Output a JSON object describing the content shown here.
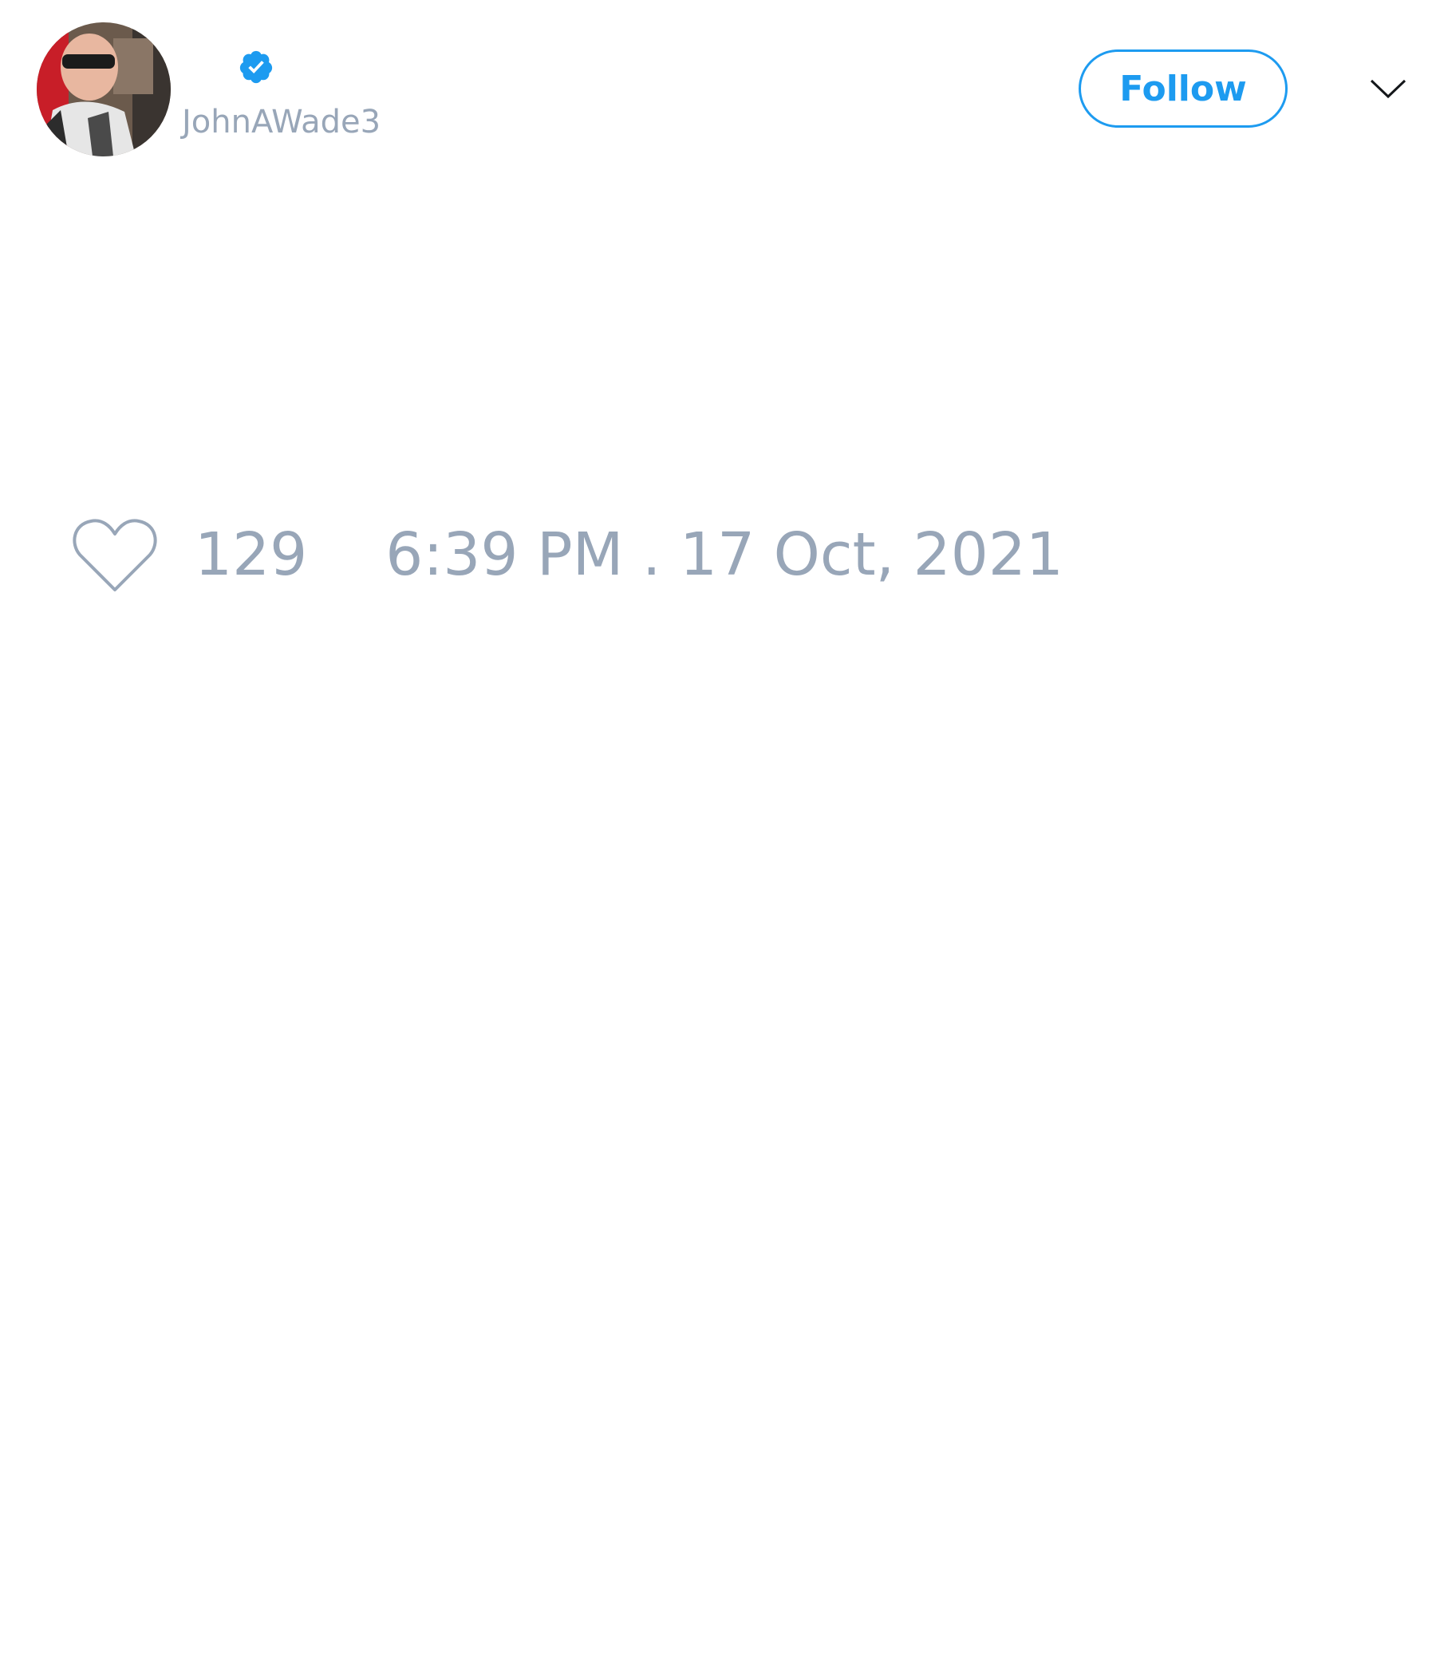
{
  "tweet": {
    "author": {
      "display_name": "",
      "username": "JohnAWade3",
      "verified": true,
      "avatar_icon": "profile-photo"
    },
    "follow_button": {
      "label": "Follow"
    },
    "more_menu": {
      "icon": "chevron-down-icon"
    },
    "actions": {
      "like_icon": "heart-outline-icon",
      "like_count": "129",
      "timestamp": "6:39 PM . 17 Oct, 2021"
    },
    "colors": {
      "accent": "#1d9bf0",
      "muted_text": "#98a6b8",
      "background": "#ffffff"
    }
  }
}
